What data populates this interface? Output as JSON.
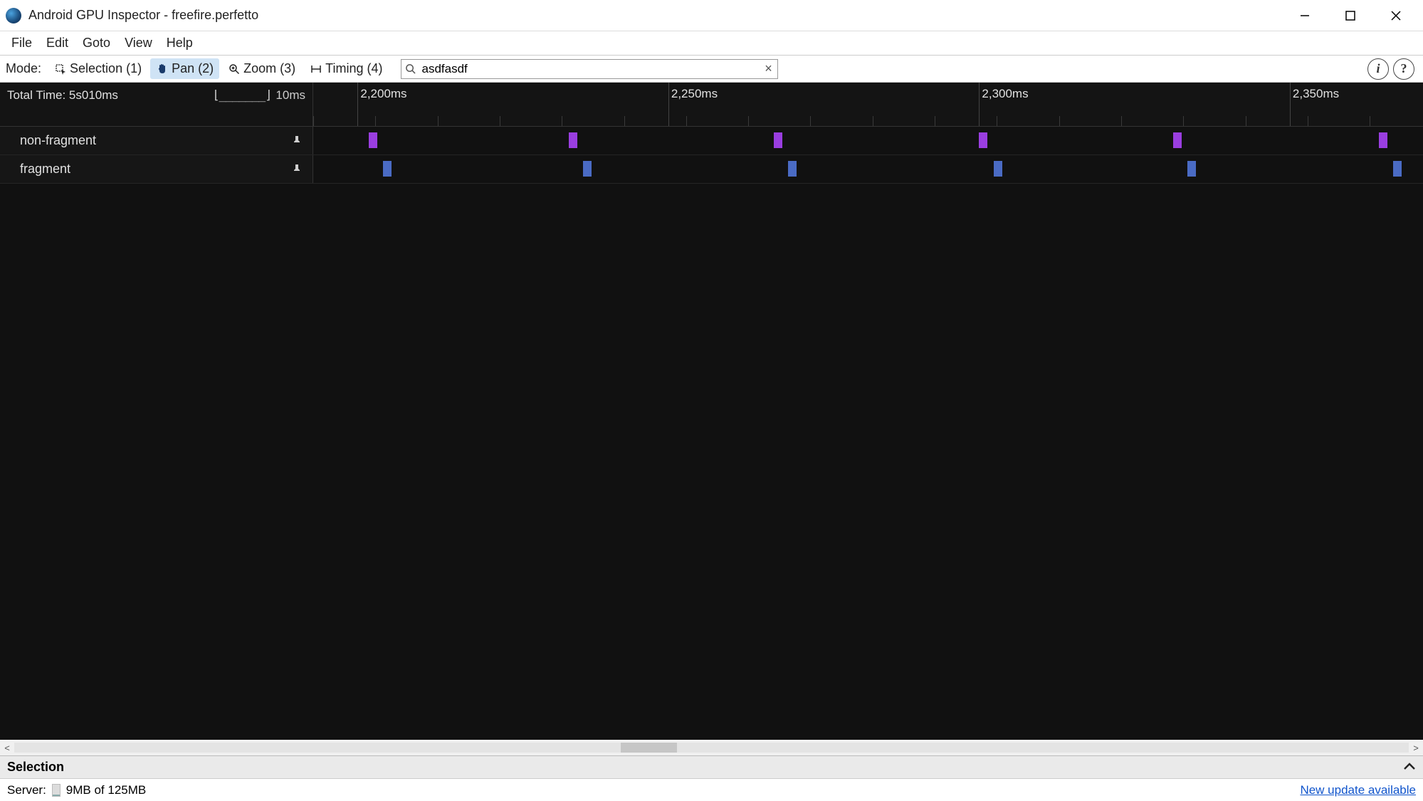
{
  "window": {
    "title": "Android GPU Inspector - freefire.perfetto"
  },
  "menu": {
    "items": [
      "File",
      "Edit",
      "Goto",
      "View",
      "Help"
    ]
  },
  "toolbar": {
    "mode_label": "Mode:",
    "tools": [
      {
        "name": "selection",
        "label": "Selection (1)",
        "active": false
      },
      {
        "name": "pan",
        "label": "Pan (2)",
        "active": true
      },
      {
        "name": "zoom",
        "label": "Zoom (3)",
        "active": false
      },
      {
        "name": "timing",
        "label": "Timing (4)",
        "active": false
      }
    ],
    "search": {
      "value": "asdfasdf",
      "placeholder": ""
    }
  },
  "timeline": {
    "total_label": "Total Time: 5s010ms",
    "scale_label": "10ms",
    "ruler": {
      "majors": [
        {
          "pos_pct": 4,
          "label": "2,200ms"
        },
        {
          "pos_pct": 32,
          "label": "2,250ms"
        },
        {
          "pos_pct": 60,
          "label": "2,300ms"
        },
        {
          "pos_pct": 88,
          "label": "2,350ms"
        }
      ],
      "minor_step_pct": 5.6
    },
    "tracks": [
      {
        "name": "non-fragment",
        "color": "purple",
        "blocks_pct": [
          5,
          23,
          41.5,
          60,
          77.5,
          96
        ]
      },
      {
        "name": "fragment",
        "color": "blue",
        "blocks_pct": [
          6.3,
          24.3,
          42.8,
          61.3,
          78.8,
          97.3
        ]
      }
    ]
  },
  "hscroll": {
    "thumb_left_pct": 43.5,
    "thumb_width_pct": 4
  },
  "selection_panel": {
    "title": "Selection"
  },
  "status": {
    "server_label": "Server:",
    "memory_text": "9MB of 125MB",
    "memory_fill_pct": 7,
    "update_text": "New update available"
  }
}
